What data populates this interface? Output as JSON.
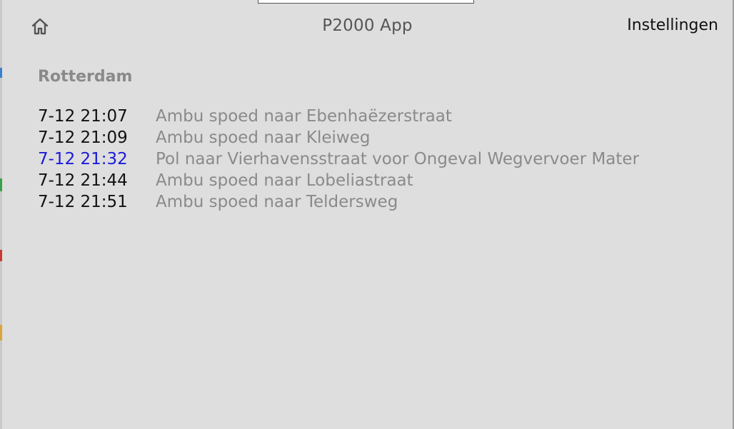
{
  "header": {
    "home_icon": "home-icon",
    "title": "P2000 App",
    "settings_label": "Instellingen"
  },
  "region": {
    "name": "Rotterdam"
  },
  "messages": [
    {
      "time": "7-12 21:07",
      "text": "Ambu spoed naar Ebenhaëzerstraat",
      "highlighted": false
    },
    {
      "time": "7-12 21:09",
      "text": "Ambu spoed naar Kleiweg",
      "highlighted": false
    },
    {
      "time": "7-12 21:32",
      "text": "Pol naar Vierhavensstraat voor Ongeval Wegvervoer Mater",
      "highlighted": true
    },
    {
      "time": "7-12 21:44",
      "text": "Ambu spoed naar Lobeliastraat",
      "highlighted": false
    },
    {
      "time": "7-12 21:51",
      "text": "Ambu spoed naar Teldersweg",
      "highlighted": false
    }
  ],
  "colors": {
    "background": "#dedede",
    "time_default": "#111111",
    "time_highlight": "#1a1adb",
    "message_text": "#8a8a8a",
    "title_text": "#555555"
  }
}
